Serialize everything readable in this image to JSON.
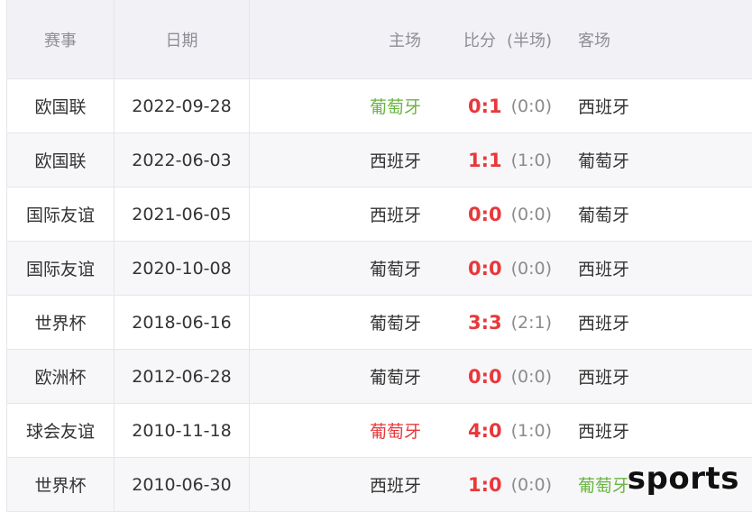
{
  "header": {
    "competition": "赛事",
    "date": "日期",
    "home": "主场",
    "score": "比分",
    "halftime": "(半场)",
    "away": "客场"
  },
  "rows": [
    {
      "competition": "欧国联",
      "date": "2022-09-28",
      "home": "葡萄牙",
      "score": "0:1",
      "halftime": "(0:0)",
      "away": "西班牙"
    },
    {
      "competition": "欧国联",
      "date": "2022-06-03",
      "home": "西班牙",
      "score": "1:1",
      "halftime": "(1:0)",
      "away": "葡萄牙"
    },
    {
      "competition": "国际友谊",
      "date": "2021-06-05",
      "home": "西班牙",
      "score": "0:0",
      "halftime": "(0:0)",
      "away": "葡萄牙"
    },
    {
      "competition": "国际友谊",
      "date": "2020-10-08",
      "home": "葡萄牙",
      "score": "0:0",
      "halftime": "(0:0)",
      "away": "西班牙"
    },
    {
      "competition": "世界杯",
      "date": "2018-06-16",
      "home": "葡萄牙",
      "score": "3:3",
      "halftime": "(2:1)",
      "away": "西班牙"
    },
    {
      "competition": "欧洲杯",
      "date": "2012-06-28",
      "home": "葡萄牙",
      "score": "0:0",
      "halftime": "(0:0)",
      "away": "西班牙"
    },
    {
      "competition": "球会友谊",
      "date": "2010-11-18",
      "home": "葡萄牙",
      "score": "4:0",
      "halftime": "(1:0)",
      "away": "西班牙"
    },
    {
      "competition": "世界杯",
      "date": "2010-06-30",
      "home": "西班牙",
      "score": "1:0",
      "halftime": "(0:0)",
      "away": "葡萄牙"
    }
  ],
  "watermark": "sports",
  "colors": {
    "winner_text": "#69b541",
    "loser_text": "#333333",
    "score_red": "#e8383b",
    "home_win_red": "#e8383b",
    "header_bg": "#f2f2f6"
  }
}
